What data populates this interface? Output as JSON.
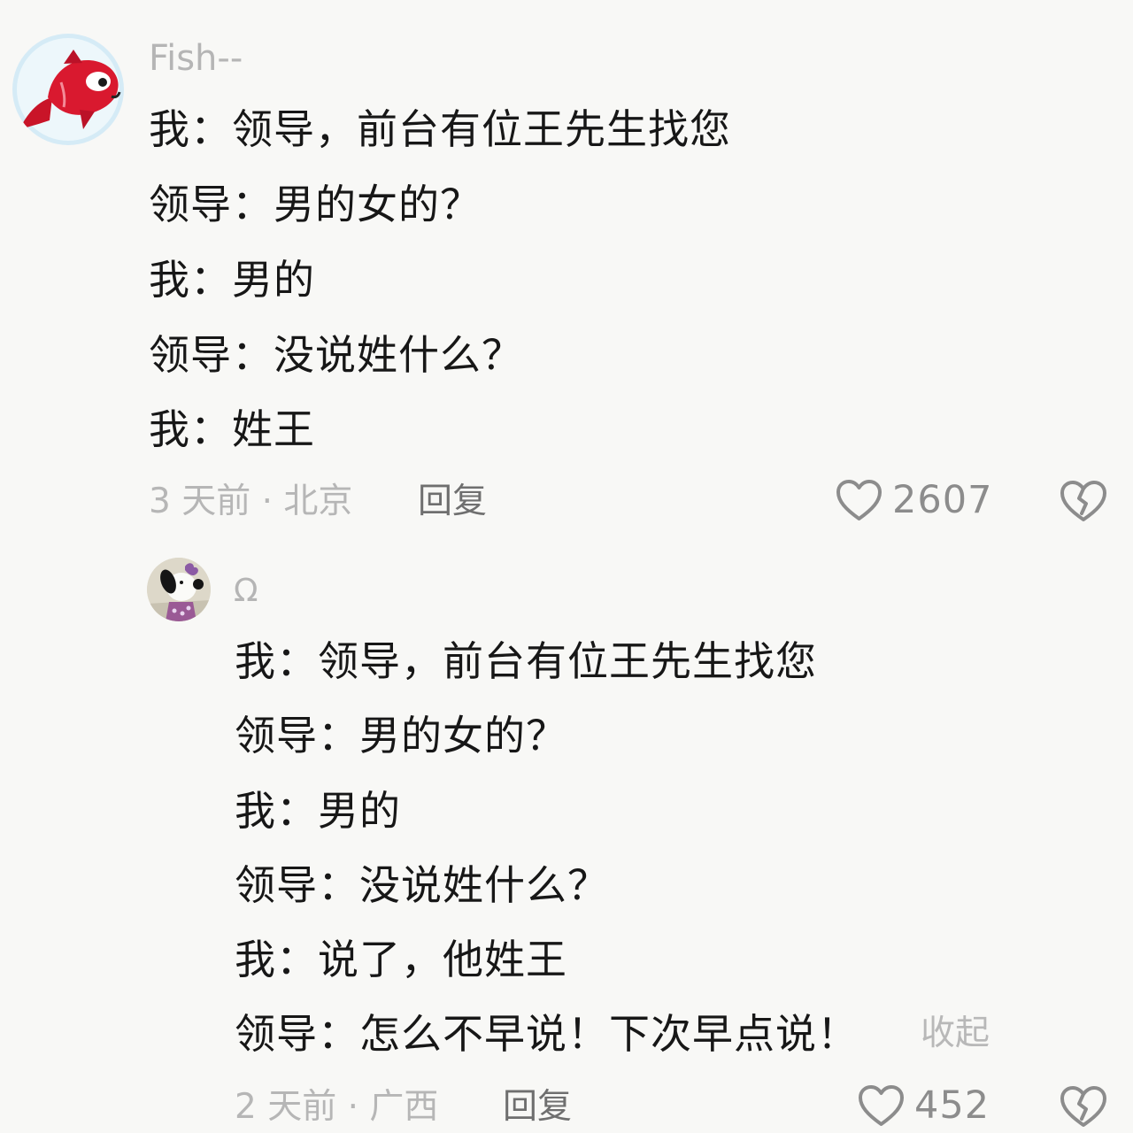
{
  "comments": [
    {
      "username": "Fish--",
      "avatar_icon": "red-fish-icon",
      "lines": [
        "我：领导，前台有位王先生找您",
        "领导：男的女的？",
        "我：男的",
        "领导：没说姓什么？",
        "我：姓王"
      ],
      "meta": "3 天前 · 北京",
      "reply_label": "回复",
      "like_count": "2607",
      "like_icon": "heart-outline-icon",
      "dislike_icon": "broken-heart-icon"
    },
    {
      "username": "Ω",
      "avatar_icon": "snoopy-avatar-icon",
      "lines": [
        "我：领导，前台有位王先生找您",
        "领导：男的女的？",
        "我：男的",
        "领导：没说姓什么？",
        "我：说了，他姓王",
        "领导：怎么不早说！下次早点说！"
      ],
      "collapse_label": "收起",
      "meta": "2 天前 · 广西",
      "reply_label": "回复",
      "like_count": "452",
      "like_icon": "heart-outline-icon",
      "dislike_icon": "broken-heart-icon"
    }
  ],
  "colors": {
    "background": "#f8f8f6",
    "text": "#171717",
    "muted": "#b6b6b6",
    "reply": "#6f6f6f",
    "icon": "#8c8c8c"
  }
}
